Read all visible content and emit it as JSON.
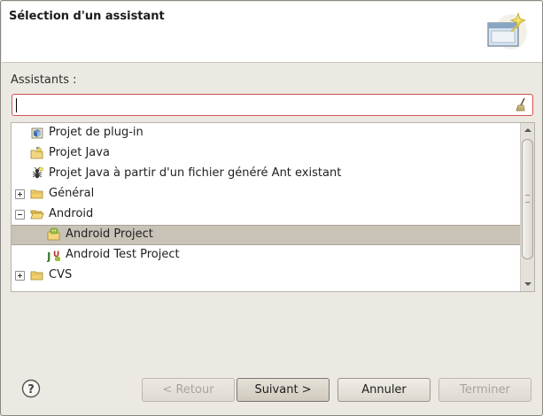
{
  "header": {
    "title": "Sélection d'un assistant",
    "banner_icon": "wizard-banner-icon"
  },
  "filter": {
    "label": "Assistants :",
    "value": "",
    "placeholder": "",
    "clear_icon": "broom-clear-icon"
  },
  "tree": {
    "items": [
      {
        "label": "Projet de plug-in",
        "icon": "plugin-project-icon",
        "level": 0,
        "expander": "none"
      },
      {
        "label": "Projet Java",
        "icon": "java-project-icon",
        "level": 0,
        "expander": "none"
      },
      {
        "label": "Projet Java à partir d'un fichier généré Ant existant",
        "icon": "ant-project-icon",
        "level": 0,
        "expander": "none"
      },
      {
        "label": "Général",
        "icon": "folder-icon",
        "level": 0,
        "expander": "collapsed"
      },
      {
        "label": "Android",
        "icon": "folder-open-icon",
        "level": 0,
        "expander": "expanded"
      },
      {
        "label": "Android Project",
        "icon": "android-project-icon",
        "level": 1,
        "expander": "none",
        "selected": true
      },
      {
        "label": "Android Test Project",
        "icon": "android-test-project-icon",
        "level": 1,
        "expander": "none"
      },
      {
        "label": "CVS",
        "icon": "folder-icon",
        "level": 0,
        "expander": "collapsed"
      }
    ]
  },
  "buttons": {
    "back": "< Retour",
    "next": "Suivant >",
    "cancel": "Annuler",
    "finish": "Terminer"
  },
  "colors": {
    "selection": "#c8c2b7",
    "filter_border": "#d9534f",
    "dialog_bg": "#ece9e2"
  }
}
